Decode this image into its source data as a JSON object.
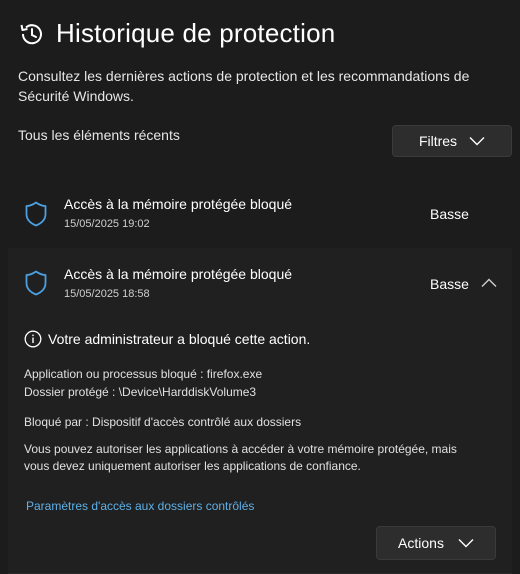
{
  "header": {
    "title": "Historique de protection",
    "icon": "history-icon"
  },
  "description": "Consultez les dernières actions de protection et les recommandations de Sécurité Windows.",
  "recent_label": "Tous les éléments récents",
  "filters_button": {
    "label": "Filtres",
    "icon": "chevron-down-icon"
  },
  "items": [
    {
      "title": "Accès à la mémoire protégée bloqué",
      "date": "15/05/2025 19:02",
      "severity": "Basse",
      "icon": "shield-icon",
      "expanded": false
    },
    {
      "title": "Accès à la mémoire protégée bloqué",
      "date": "15/05/2025 18:58",
      "severity": "Basse",
      "icon": "shield-icon",
      "expanded": true,
      "info": "Votre administrateur a bloqué cette action.",
      "app_line": "Application ou processus bloqué :  firefox.exe",
      "folder_line": "Dossier protégé :  \\Device\\HarddiskVolume3",
      "blocked_by_line": "Bloqué par :  Dispositif d'accès contrôlé aux dossiers",
      "note_line1": "Vous pouvez autoriser les applications à accéder à votre mémoire protégée, mais",
      "note_line2": "vous devez uniquement autoriser les applications de confiance.",
      "link": "Paramètres d'accès aux dossiers contrôlés",
      "actions_button": "Actions"
    }
  ],
  "colors": {
    "background": "#1c1c1c",
    "expanded_bg": "#202020",
    "accent": "#4ca0e0",
    "link": "#5fb0e8"
  }
}
